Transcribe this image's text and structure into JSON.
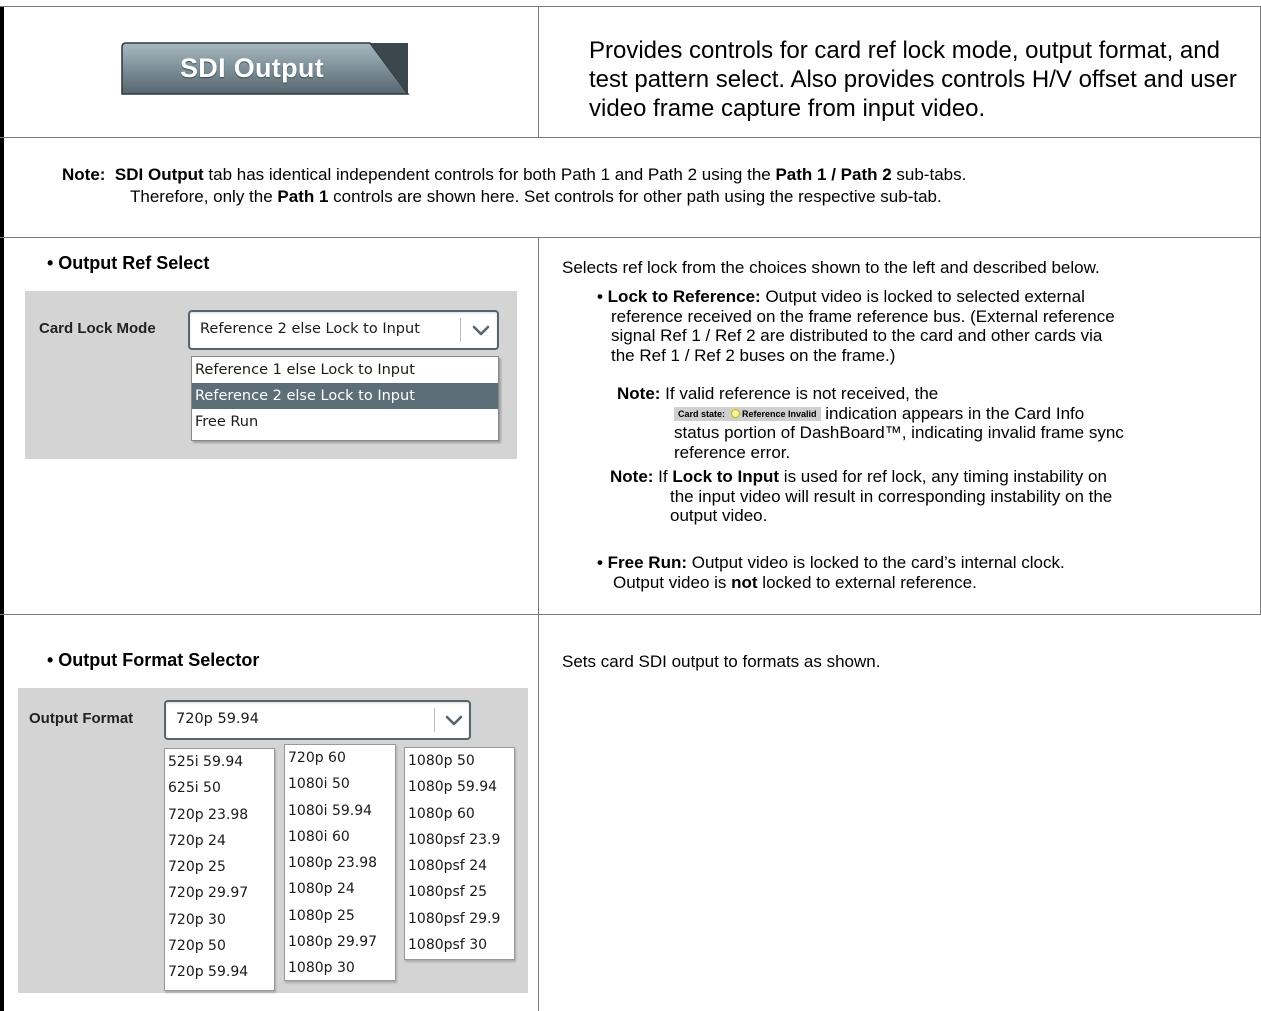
{
  "header": {
    "tab_label": "SDI Output",
    "intro_text": "Provides controls for card ref lock mode, output format, and test pattern select. Also provides controls H/V offset and user video frame capture from input video."
  },
  "note": {
    "prefix": "Note:",
    "tab_name": "SDI Output",
    "text1": " tab has identical independent controls for both Path 1 and Path 2 using the ",
    "sub_tabs": "Path 1 / Path 2",
    "text2": " sub-tabs.",
    "text3": "Therefore, only the ",
    "path1": "Path 1",
    "text4": " controls are shown here. Set controls for other path using the respective sub-tab."
  },
  "ref_section": {
    "title": "• Output Ref Select",
    "field_label": "Card Lock Mode",
    "selected_value": "Reference 2 else Lock to Input",
    "options": [
      "Reference 1 else Lock to Input",
      "Reference 2 else Lock to Input",
      "Free Run"
    ],
    "selected_index": 1,
    "desc_intro": "Selects ref lock from the choices shown to the left and described below.",
    "lock_ref_label": "• Lock to Reference:",
    "lock_ref_line1": " Output video is locked to selected external",
    "lock_ref_line2": "reference received on the frame reference bus. (External reference",
    "lock_ref_line3": "signal Ref 1 / Ref 2 are distributed to the card and other cards via",
    "lock_ref_line4": "the Ref 1 / Ref 2 buses on the frame.)",
    "note1_prefix": "Note:",
    "note1_line1": " If valid reference is not received, the",
    "badge_state": "Card state:",
    "badge_text": "Reference Invalid",
    "note1_line2": " indication appears in the Card Info",
    "note1_line3": "status portion of DashBoard™, indicating invalid frame sync",
    "note1_line4": "reference error.",
    "note2_prefix": "Note:",
    "note2_a": " If ",
    "note2_bold": "Lock to Input",
    "note2_b": " is used for ref lock, any timing instability on",
    "note2_line2": "the input video will result in corresponding instability on the",
    "note2_line3": "output video.",
    "free_run_label": "• Free Run:",
    "free_run_line1": " Output video is locked to the card’s internal clock.",
    "free_run_line2a": "Output video is ",
    "free_run_not": "not",
    "free_run_line2b": " locked to external reference."
  },
  "format_section": {
    "title": "• Output Format Selector",
    "field_label": "Output Format",
    "selected_value": "720p 59.94",
    "columns": [
      [
        "525i 59.94",
        "625i 50",
        "720p 23.98",
        "720p 24",
        "720p 25",
        "720p 29.97",
        "720p 30",
        "720p 50",
        "720p 59.94"
      ],
      [
        "720p 60",
        "1080i 50",
        "1080i 59.94",
        "1080i 60",
        "1080p 23.98",
        "1080p 24",
        "1080p 25",
        "1080p 29.97",
        "1080p 30"
      ],
      [
        "1080p 50",
        "1080p 59.94",
        "1080p 60",
        "1080psf 23.9",
        "1080psf 24",
        "1080psf 25",
        "1080psf 29.9",
        "1080psf 30"
      ]
    ],
    "desc": "Sets card SDI output to formats as shown."
  },
  "icons": {
    "dropdown_chevron": "chevron-down-icon",
    "status_dot": "status-dot-icon"
  },
  "colors": {
    "tab_gradient_top": "#9fb0b8",
    "tab_gradient_bottom": "#56666e",
    "selected_option": "#5c6e78",
    "panel_bg": "#d4d4d4"
  }
}
